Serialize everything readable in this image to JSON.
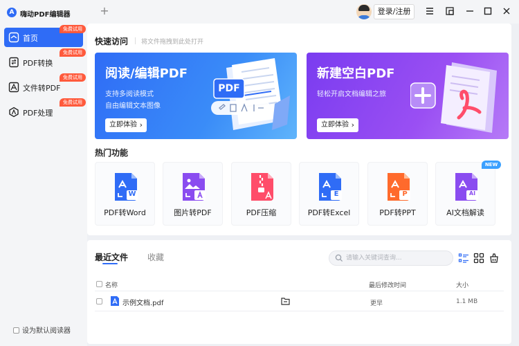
{
  "app": {
    "title": "嗨动PDF编辑器",
    "logo_letter": "A"
  },
  "titlebar": {
    "new_tab_label": "+",
    "login_label": "登录/注册"
  },
  "sidebar": {
    "items": [
      {
        "label": "首页",
        "badge": "免费试用",
        "icon": "home-icon",
        "active": true
      },
      {
        "label": "PDF转换",
        "badge": "免费试用",
        "icon": "convert-icon",
        "active": false
      },
      {
        "label": "文件转PDF",
        "badge": "免费试用",
        "icon": "file-to-pdf-icon",
        "active": false
      },
      {
        "label": "PDF处理",
        "badge": "免费试用",
        "icon": "pdf-process-icon",
        "active": false
      }
    ],
    "default_reader_label": "设为默认阅读器"
  },
  "quick_access": {
    "title": "快速访问",
    "hint": "将文件拖拽到此处打开",
    "cards": [
      {
        "title": "阅读/编辑PDF",
        "desc1": "支持多阅读模式",
        "desc2": "自由编辑文本图像",
        "button": "立即体验",
        "illustration_text": "PDF"
      },
      {
        "title": "新建空白PDF",
        "desc1": "轻松开启文档编辑之旅",
        "button": "立即体验"
      }
    ]
  },
  "hot_features": {
    "title": "热门功能",
    "new_badge": "NEW",
    "items": [
      {
        "label": "PDF转Word",
        "letter": "W",
        "color": "#2f6cf6"
      },
      {
        "label": "图片转PDF",
        "letter": "",
        "color": "#8a4cf0"
      },
      {
        "label": "PDF压缩",
        "letter": "",
        "color": "#ff4d6a"
      },
      {
        "label": "PDF转Excel",
        "letter": "E",
        "color": "#2f6cf6"
      },
      {
        "label": "PDF转PPT",
        "letter": "P",
        "color": "#ff6a2c"
      },
      {
        "label": "AI文档解读",
        "letter": "AI",
        "color": "#8a4cf0"
      }
    ]
  },
  "files": {
    "tabs": [
      "最近文件",
      "收藏"
    ],
    "search_placeholder": "请输入关键词查询...",
    "columns": {
      "name": "名称",
      "modified": "最后修改时间",
      "size": "大小"
    },
    "rows": [
      {
        "name": "示例文档.pdf",
        "modified": "更早",
        "size": "1.1 MB"
      }
    ]
  },
  "colors": {
    "accent": "#2f6cf6",
    "badge": "#ff5a3c",
    "purple": "#8a4cf0"
  }
}
